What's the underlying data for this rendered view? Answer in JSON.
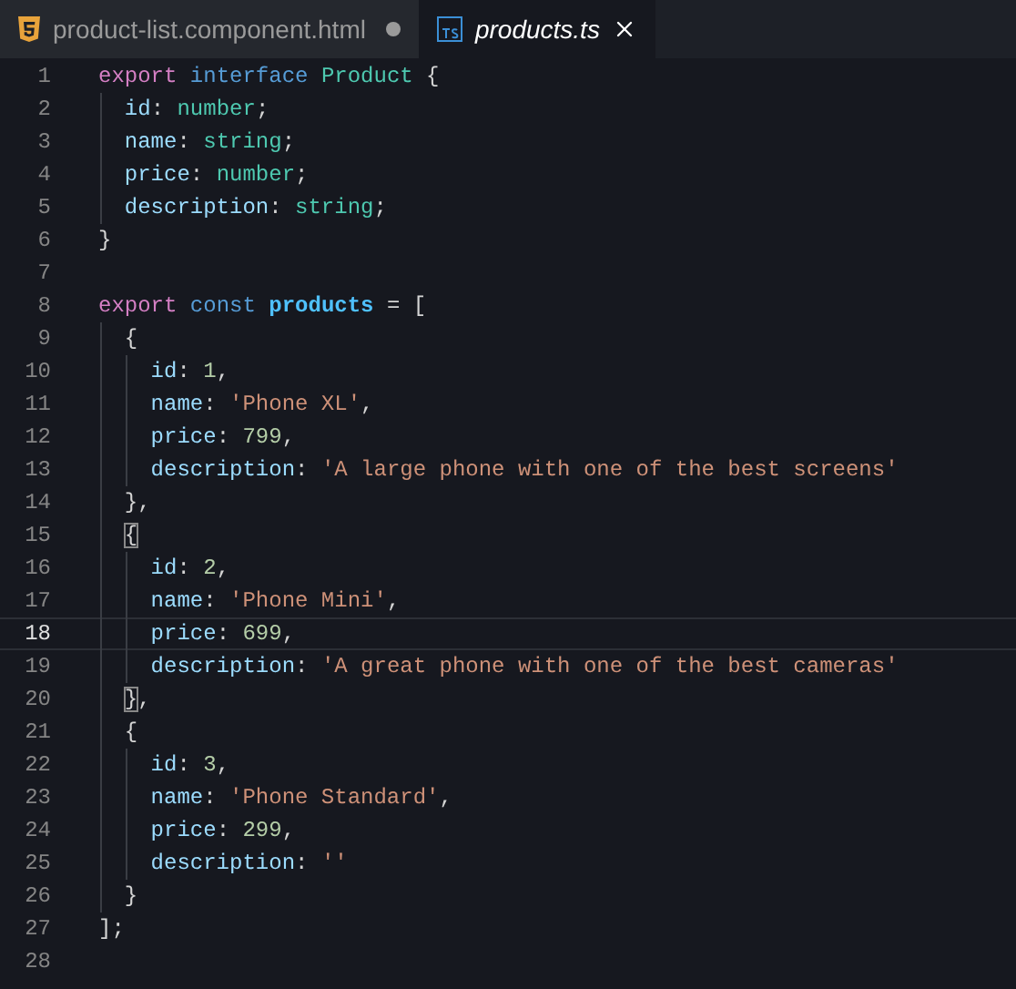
{
  "tabs": [
    {
      "label": "product-list.component.html",
      "kind": "html",
      "selected": false,
      "modified": true
    },
    {
      "label": "products.ts",
      "kind": "ts",
      "selected": true,
      "modified": false
    }
  ],
  "editor": {
    "lines": [
      {
        "number": "1",
        "current": false,
        "tokens": [
          {
            "kind": "keyword",
            "text": "export "
          },
          {
            "kind": "storage",
            "text": "interface "
          },
          {
            "kind": "type",
            "text": "Product "
          },
          {
            "kind": "plain",
            "text": "{"
          }
        ]
      },
      {
        "number": "2",
        "current": false,
        "tokens": [
          {
            "kind": "prop",
            "text": "  id"
          },
          {
            "kind": "plain",
            "text": ": "
          },
          {
            "kind": "type",
            "text": "number"
          },
          {
            "kind": "plain",
            "text": ";"
          }
        ]
      },
      {
        "number": "3",
        "current": false,
        "tokens": [
          {
            "kind": "prop",
            "text": "  name"
          },
          {
            "kind": "plain",
            "text": ": "
          },
          {
            "kind": "type",
            "text": "string"
          },
          {
            "kind": "plain",
            "text": ";"
          }
        ]
      },
      {
        "number": "4",
        "current": false,
        "tokens": [
          {
            "kind": "prop",
            "text": "  price"
          },
          {
            "kind": "plain",
            "text": ": "
          },
          {
            "kind": "type",
            "text": "number"
          },
          {
            "kind": "plain",
            "text": ";"
          }
        ]
      },
      {
        "number": "5",
        "current": false,
        "tokens": [
          {
            "kind": "prop",
            "text": "  description"
          },
          {
            "kind": "plain",
            "text": ": "
          },
          {
            "kind": "type",
            "text": "string"
          },
          {
            "kind": "plain",
            "text": ";"
          }
        ]
      },
      {
        "number": "6",
        "current": false,
        "tokens": [
          {
            "kind": "plain",
            "text": "}"
          }
        ]
      },
      {
        "number": "7",
        "current": false
      },
      {
        "number": "8",
        "current": false,
        "tokens": [
          {
            "kind": "keyword",
            "text": "export "
          },
          {
            "kind": "storage",
            "text": "const "
          },
          {
            "kind": "variable",
            "text": "products"
          },
          {
            "kind": "plain",
            "text": " = ["
          }
        ]
      },
      {
        "number": "9",
        "current": false,
        "tokens": [
          {
            "kind": "plain",
            "text": "  {"
          }
        ]
      },
      {
        "number": "10",
        "current": false,
        "tokens": [
          {
            "kind": "prop",
            "text": "    id"
          },
          {
            "kind": "plain",
            "text": ": "
          },
          {
            "kind": "number",
            "text": "1"
          },
          {
            "kind": "plain",
            "text": ","
          }
        ]
      },
      {
        "number": "11",
        "current": false,
        "tokens": [
          {
            "kind": "prop",
            "text": "    name"
          },
          {
            "kind": "plain",
            "text": ": "
          },
          {
            "kind": "string",
            "text": "'Phone XL'"
          },
          {
            "kind": "plain",
            "text": ","
          }
        ]
      },
      {
        "number": "12",
        "current": false,
        "tokens": [
          {
            "kind": "prop",
            "text": "    price"
          },
          {
            "kind": "plain",
            "text": ": "
          },
          {
            "kind": "number",
            "text": "799"
          },
          {
            "kind": "plain",
            "text": ","
          }
        ]
      },
      {
        "number": "13",
        "current": false,
        "tokens": [
          {
            "kind": "prop",
            "text": "    description"
          },
          {
            "kind": "plain",
            "text": ": "
          },
          {
            "kind": "string",
            "text": "'A large phone with one of the best screens'"
          }
        ]
      },
      {
        "number": "14",
        "current": false,
        "tokens": [
          {
            "kind": "plain",
            "text": "  },"
          }
        ]
      },
      {
        "number": "15",
        "current": false,
        "tokens": [
          {
            "kind": "bracket-match",
            "text": "  {"
          }
        ]
      },
      {
        "number": "16",
        "current": false,
        "tokens": [
          {
            "kind": "prop",
            "text": "    id"
          },
          {
            "kind": "plain",
            "text": ": "
          },
          {
            "kind": "number",
            "text": "2"
          },
          {
            "kind": "plain",
            "text": ","
          }
        ]
      },
      {
        "number": "17",
        "current": false,
        "tokens": [
          {
            "kind": "prop",
            "text": "    name"
          },
          {
            "kind": "plain",
            "text": ": "
          },
          {
            "kind": "string",
            "text": "'Phone Mini'"
          },
          {
            "kind": "plain",
            "text": ","
          }
        ]
      },
      {
        "number": "18",
        "current": true,
        "tokens": [
          {
            "kind": "prop",
            "text": "    price"
          },
          {
            "kind": "plain",
            "text": ": "
          },
          {
            "kind": "number",
            "text": "699"
          },
          {
            "kind": "plain",
            "text": ","
          }
        ]
      },
      {
        "number": "19",
        "current": false,
        "tokens": [
          {
            "kind": "prop",
            "text": "    description"
          },
          {
            "kind": "plain",
            "text": ": "
          },
          {
            "kind": "string",
            "text": "'A great phone with one of the best cameras'"
          }
        ]
      },
      {
        "number": "20",
        "current": false,
        "tokens": [
          {
            "kind": "bracket-match",
            "text": "  }"
          },
          {
            "kind": "plain",
            "text": ","
          }
        ]
      },
      {
        "number": "21",
        "current": false,
        "tokens": [
          {
            "kind": "plain",
            "text": "  {"
          }
        ]
      },
      {
        "number": "22",
        "current": false,
        "tokens": [
          {
            "kind": "prop",
            "text": "    id"
          },
          {
            "kind": "plain",
            "text": ": "
          },
          {
            "kind": "number",
            "text": "3"
          },
          {
            "kind": "plain",
            "text": ","
          }
        ]
      },
      {
        "number": "23",
        "current": false,
        "tokens": [
          {
            "kind": "prop",
            "text": "    name"
          },
          {
            "kind": "plain",
            "text": ": "
          },
          {
            "kind": "string",
            "text": "'Phone Standard'"
          },
          {
            "kind": "plain",
            "text": ","
          }
        ]
      },
      {
        "number": "24",
        "current": false,
        "tokens": [
          {
            "kind": "prop",
            "text": "    price"
          },
          {
            "kind": "plain",
            "text": ": "
          },
          {
            "kind": "number",
            "text": "299"
          },
          {
            "kind": "plain",
            "text": ","
          }
        ]
      },
      {
        "number": "25",
        "current": false,
        "tokens": [
          {
            "kind": "prop",
            "text": "    description"
          },
          {
            "kind": "plain",
            "text": ": "
          },
          {
            "kind": "string",
            "text": "''"
          }
        ]
      },
      {
        "number": "26",
        "current": false,
        "tokens": [
          {
            "kind": "plain",
            "text": "  }"
          }
        ]
      },
      {
        "number": "27",
        "current": false,
        "tokens": [
          {
            "kind": "plain",
            "text": "];"
          }
        ]
      },
      {
        "number": "28",
        "current": false
      }
    ]
  }
}
